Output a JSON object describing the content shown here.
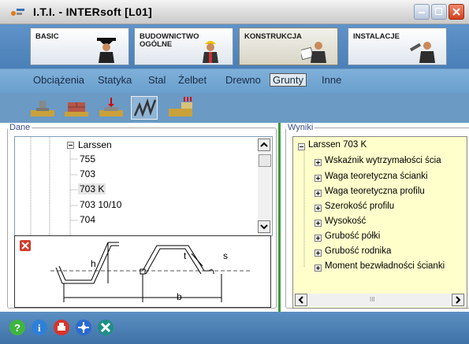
{
  "window": {
    "title": "I.T.I. - INTERsoft [L01]"
  },
  "modules": [
    {
      "label": "BASIC",
      "icon": "graduate-icon"
    },
    {
      "label": "BUDOWNICTWO\nOGÓLNE",
      "icon": "builder-icon"
    },
    {
      "label": "KONSTRUKCJA",
      "icon": "engineer-icon"
    },
    {
      "label": "INSTALACJE",
      "icon": "plumber-icon"
    }
  ],
  "subtabs": [
    "Obciążenia",
    "Statyka",
    "Stal",
    "Żelbet",
    "Drewno",
    "Grunty",
    "Inne"
  ],
  "selected_subtab": "Grunty",
  "toolbar": [
    "foundation-icon",
    "wall-icon",
    "footing-load-icon",
    "sheet-pile-icon",
    "excavation-icon"
  ],
  "dane": {
    "legend": "Dane",
    "tree_parent": "Larssen",
    "tree_items": [
      "755",
      "703",
      "703 K",
      "703 10/10",
      "704",
      "..."
    ],
    "selected_item": "703 K"
  },
  "drawing": {
    "labels": {
      "h": "h",
      "b": "b",
      "t": "t",
      "s": "s"
    }
  },
  "wyniki": {
    "legend": "Wyniki",
    "root": "Larssen 703 K",
    "items": [
      "Wskaźnik wytrzymałości ścia",
      "Waga teoretyczna ścianki",
      "Waga teoretyczna profilu",
      "Szerokość profilu",
      "Wysokość",
      "Grubość półki",
      "Grubość rodnika",
      "Moment bezwładności ścianki"
    ],
    "hscroll_label": "III"
  },
  "bottom_icons": [
    "help-icon",
    "info-icon",
    "print-icon",
    "network-icon",
    "tools-icon"
  ],
  "colors": {
    "module_bar": "#4a7fb7",
    "result_bg": "#ffffcc",
    "divider": "#3a9a3a"
  }
}
